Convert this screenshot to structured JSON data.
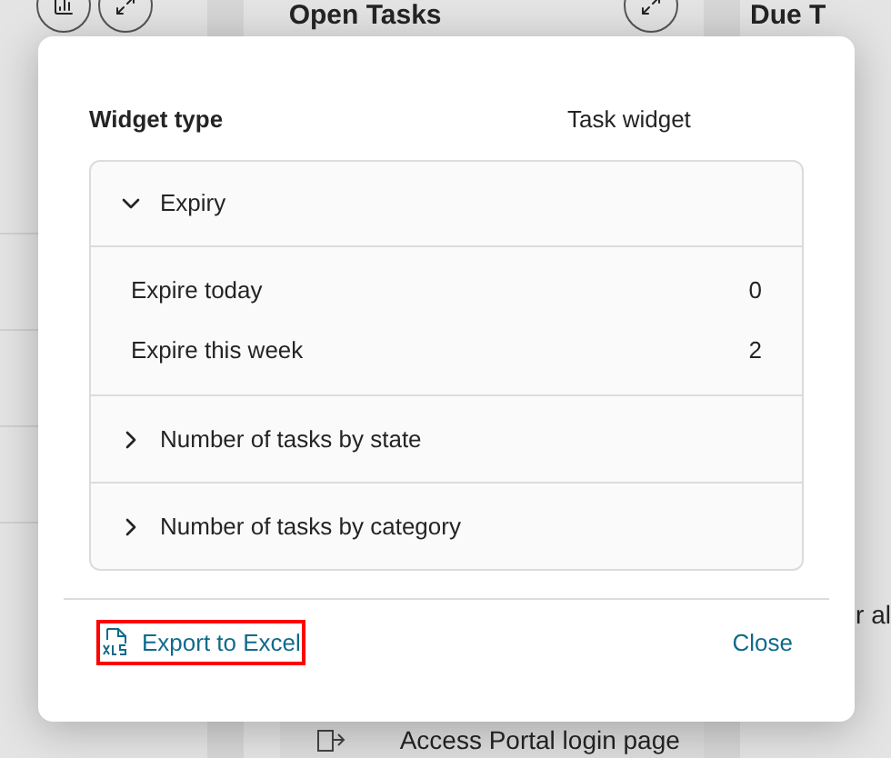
{
  "background": {
    "open_tasks_title": "Open Tasks",
    "due_title": "Due T",
    "side_fragment": "r al",
    "task_item": "Access Portal login page"
  },
  "dialog": {
    "label": "Widget type",
    "value": "Task widget",
    "sections": [
      {
        "title": "Expiry",
        "expanded": true,
        "rows": [
          {
            "label": "Expire today",
            "count": "0"
          },
          {
            "label": "Expire this week",
            "count": "2"
          }
        ]
      },
      {
        "title": "Number of tasks by state",
        "expanded": false
      },
      {
        "title": "Number of tasks by category",
        "expanded": false
      }
    ],
    "export_link": {
      "label": "Export to Excel",
      "highlighted": true
    },
    "close_button": "Close"
  }
}
